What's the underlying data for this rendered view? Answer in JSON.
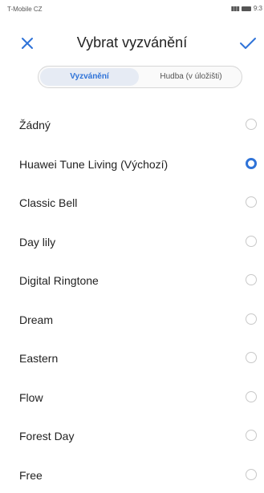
{
  "status_bar": {
    "carrier": "T-Mobile CZ",
    "time": "9:3",
    "signal_icon": "signal-icon",
    "battery_icon": "battery-icon"
  },
  "header": {
    "title": "Vybrat vyzvánění",
    "close_icon": "close-icon",
    "confirm_icon": "checkmark-icon",
    "accent": "#2f73d8"
  },
  "tabs": [
    {
      "label": "Vyzvánění",
      "active": true
    },
    {
      "label": "Hudba (v úložišti)",
      "active": false
    }
  ],
  "ringtones": [
    {
      "label": "Žádný",
      "selected": false
    },
    {
      "label": "Huawei Tune Living (Výchozí)",
      "selected": true
    },
    {
      "label": "Classic Bell",
      "selected": false
    },
    {
      "label": "Day lily",
      "selected": false
    },
    {
      "label": "Digital Ringtone",
      "selected": false
    },
    {
      "label": "Dream",
      "selected": false
    },
    {
      "label": "Eastern",
      "selected": false
    },
    {
      "label": "Flow",
      "selected": false
    },
    {
      "label": "Forest Day",
      "selected": false
    },
    {
      "label": "Free",
      "selected": false
    }
  ]
}
